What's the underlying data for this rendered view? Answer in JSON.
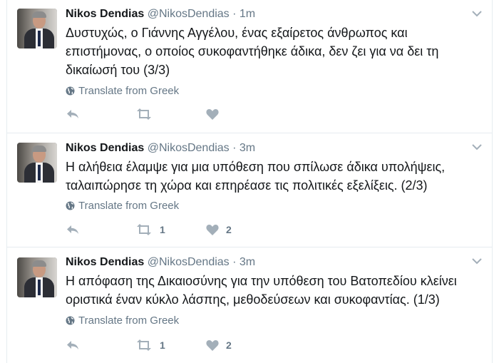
{
  "colors": {
    "text": "#14171a",
    "muted": "#657786",
    "border": "#e6ecf0",
    "icon": "#a3afb9"
  },
  "icons": {
    "reply": "reply-icon",
    "retweet": "retweet-icon",
    "like": "heart-icon",
    "globe": "globe-icon",
    "menu": "chevron-down-icon"
  },
  "tweets": [
    {
      "name": "Nikos Dendias",
      "handle": "@NikosDendias",
      "dot": "·",
      "time": "1m",
      "line1": "Δυστυχώς, ο Γιάννης Αγγέλου, ένας εξαίρετος άνθρωπος και",
      "line2": "επιστήμονας, ο οποίος συκοφαντήθηκε άδικα, δεν ζει για να δει τη",
      "line3": "δικαίωσή του (3/3)",
      "translate": "Translate from Greek",
      "retweets": "",
      "likes": ""
    },
    {
      "name": "Nikos Dendias",
      "handle": "@NikosDendias",
      "dot": "·",
      "time": "3m",
      "line1": "Η αλήθεια έλαμψε για μια υπόθεση που σπίλωσε άδικα υπολήψεις,",
      "line2": "ταλαιπώρησε τη χώρα και επηρέασε τις πολιτικές εξελίξεις. (2/3)",
      "translate": "Translate from Greek",
      "retweets": "1",
      "likes": "2"
    },
    {
      "name": "Nikos Dendias",
      "handle": "@NikosDendias",
      "dot": "·",
      "time": "3m",
      "line1": "Η απόφαση της Δικαιοσύνης για την υπόθεση του Βατοπεδίου κλείνει",
      "line2": "οριστικά έναν κύκλο λάσπης, μεθοδεύσεων και συκοφαντίας. (1/3)",
      "translate": "Translate from Greek",
      "retweets": "1",
      "likes": "2"
    }
  ]
}
